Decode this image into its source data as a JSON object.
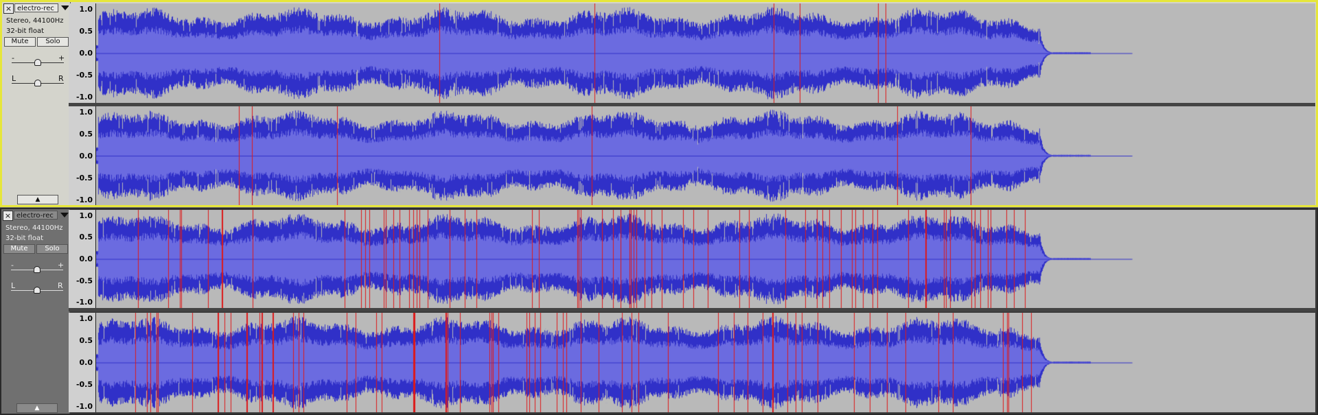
{
  "colors": {
    "wave_dark": "#3030c8",
    "wave_rms": "#6b6be0",
    "wave_bg": "#b9b9b9",
    "clip": "#dd1818",
    "selected_border": "#e6e63a"
  },
  "tracks": [
    {
      "name": "electro-rec",
      "format": "Stereo, 44100Hz",
      "bitdepth": "32-bit float",
      "mute": "Mute",
      "solo": "Solo",
      "gain_minus": "-",
      "gain_plus": "+",
      "pan_left": "L",
      "pan_right": "R",
      "gain_level": 0.5,
      "pan_level": 0.5,
      "collapse_icon": "triangle-up-icon",
      "close_icon": "close-icon",
      "menu_icon": "dropdown-triangle-icon",
      "clip_count": 6
    },
    {
      "name": "electro-rec",
      "format": "Stereo, 44100Hz",
      "bitdepth": "32-bit float",
      "mute": "Mute",
      "solo": "Solo",
      "gain_minus": "-",
      "gain_plus": "+",
      "pan_left": "L",
      "pan_right": "R",
      "gain_level": 0.5,
      "pan_level": 0.5,
      "collapse_icon": "triangle-up-icon",
      "close_icon": "close-icon",
      "menu_icon": "dropdown-triangle-icon",
      "clip_count": 70
    }
  ],
  "axis_ticks": [
    "1.0",
    "0.5",
    "0.0",
    "-0.5",
    "-1.0"
  ]
}
